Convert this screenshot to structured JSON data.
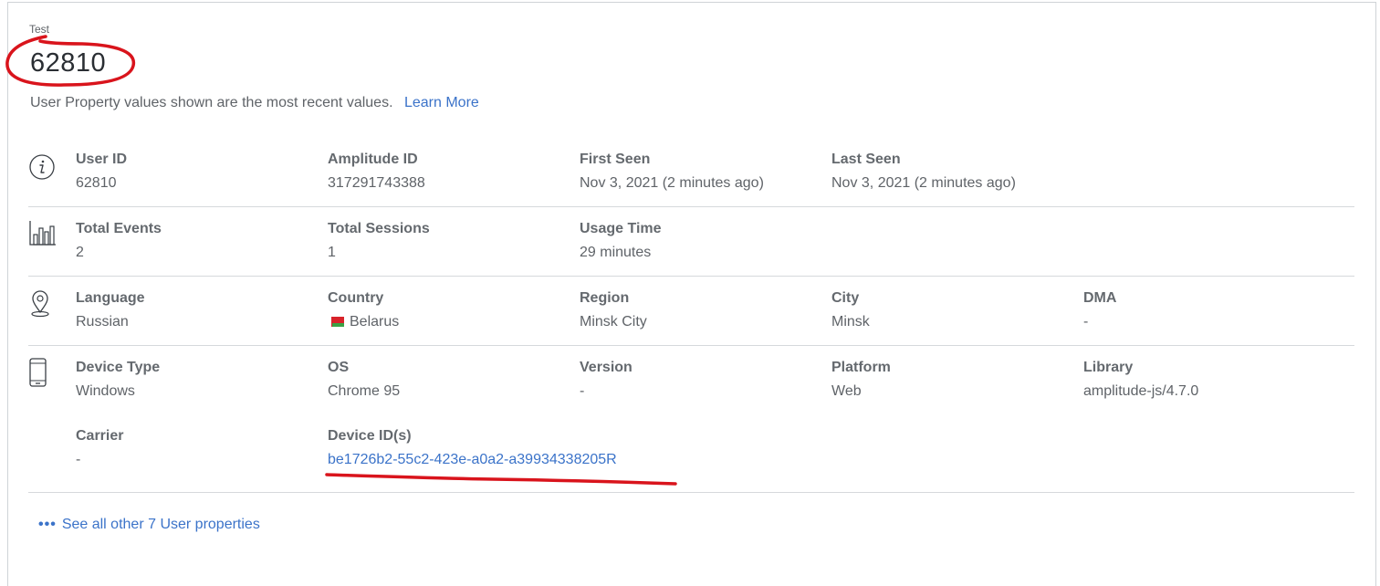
{
  "header": {
    "small_label": "Test",
    "title": "62810",
    "notice": "User Property values shown are the most recent values.",
    "learn_more": "Learn More"
  },
  "rows": {
    "identity": {
      "icon": "info-icon",
      "cells": [
        {
          "label": "User ID",
          "value": "62810"
        },
        {
          "label": "Amplitude ID",
          "value": "317291743388"
        },
        {
          "label": "First Seen",
          "value": "Nov 3, 2021 (2 minutes ago)"
        },
        {
          "label": "Last Seen",
          "value": "Nov 3, 2021 (2 minutes ago)"
        }
      ]
    },
    "usage": {
      "icon": "bar-chart-icon",
      "cells": [
        {
          "label": "Total Events",
          "value": "2"
        },
        {
          "label": "Total Sessions",
          "value": "1"
        },
        {
          "label": "Usage Time",
          "value": "29 minutes"
        }
      ]
    },
    "location": {
      "icon": "location-pin-icon",
      "cells": [
        {
          "label": "Language",
          "value": "Russian"
        },
        {
          "label": "Country",
          "value": "Belarus"
        },
        {
          "label": "Region",
          "value": "Minsk City"
        },
        {
          "label": "City",
          "value": "Minsk"
        },
        {
          "label": "DMA",
          "value": "-"
        }
      ]
    },
    "device": {
      "icon": "mobile-device-icon",
      "cells": [
        {
          "label": "Device Type",
          "value": "Windows"
        },
        {
          "label": "OS",
          "value": "Chrome 95"
        },
        {
          "label": "Version",
          "value": "-"
        },
        {
          "label": "Platform",
          "value": "Web"
        },
        {
          "label": "Library",
          "value": "amplitude-js/4.7.0"
        },
        {
          "label": "Carrier",
          "value": "-"
        },
        {
          "label": "Device ID(s)",
          "value": "be1726b2-55c2-423e-a0a2-a39934338205R"
        }
      ]
    }
  },
  "footer": {
    "see_all": "See all other 7 User properties"
  },
  "colors": {
    "link": "#3b73c9",
    "annotation": "#d9141c"
  }
}
